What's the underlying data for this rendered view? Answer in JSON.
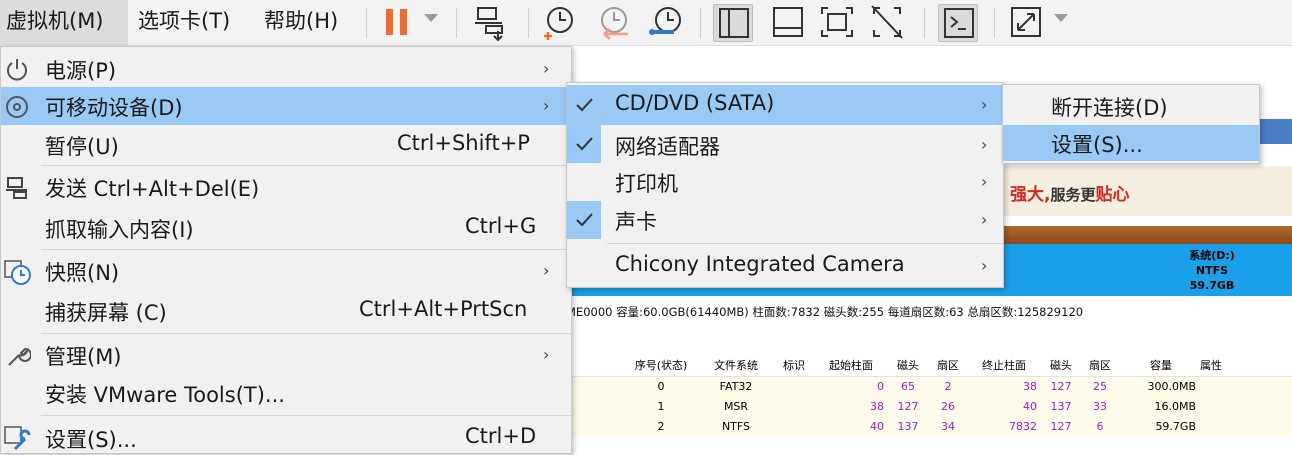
{
  "menubar": {
    "items": [
      "虚拟机(M)",
      "选项卡(T)",
      "帮助(H)"
    ]
  },
  "toolbar": {
    "icons": [
      "pause-icon",
      "send-ctrl-alt-del-icon",
      "snapshot-take-icon",
      "snapshot-revert-icon",
      "snapshot-manager-icon",
      "sidebar-view-icon",
      "thumbnail-view-icon",
      "fullscreen-icon",
      "unity-off-icon",
      "console-icon",
      "stretch-icon"
    ],
    "accent_pause": "#f26b2a"
  },
  "vm_menu": {
    "items": [
      {
        "label": "电源(P)",
        "shortcut": "",
        "submenu": true
      },
      {
        "label": "可移动设备(D)",
        "shortcut": "",
        "submenu": true
      },
      {
        "label": "暂停(U)",
        "shortcut": "Ctrl+Shift+P",
        "submenu": false
      },
      {
        "label": "发送 Ctrl+Alt+Del(E)",
        "shortcut": "",
        "submenu": false
      },
      {
        "label": "抓取输入内容(I)",
        "shortcut": "Ctrl+G",
        "submenu": false
      },
      {
        "label": "快照(N)",
        "shortcut": "",
        "submenu": true
      },
      {
        "label": "捕获屏幕 (C)",
        "shortcut": "Ctrl+Alt+PrtScn",
        "submenu": false
      },
      {
        "label": "管理(M)",
        "shortcut": "",
        "submenu": true
      },
      {
        "label": "安装 VMware Tools(T)...",
        "shortcut": "",
        "submenu": false
      },
      {
        "label": "设置(S)...",
        "shortcut": "Ctrl+D",
        "submenu": false
      }
    ]
  },
  "devices_menu": {
    "items": [
      {
        "label": "CD/DVD (SATA)",
        "checked": true
      },
      {
        "label": "网络适配器",
        "checked": true
      },
      {
        "label": "打印机",
        "checked": false
      },
      {
        "label": "声卡",
        "checked": true
      },
      {
        "label": "Chicony Integrated Camera",
        "checked": false
      }
    ]
  },
  "cd_menu": {
    "items": [
      "断开连接(D)",
      "设置(S)..."
    ]
  },
  "background": {
    "banner": "强大,",
    "banner_b": "服务更",
    "banner_c": "贴心",
    "disk_label": [
      "系统(D:)",
      "NTFS",
      "59.7GB"
    ],
    "info": "ME0000  容量:60.0GB(61440MB)  柱面数:7832  磁头数:255  每道扇区数:63  总扇区数:125829120",
    "table_headers": [
      "序号(状态)",
      "文件系统",
      "标识",
      "起始柱面",
      "磁头",
      "扇区",
      "终止柱面",
      "磁头",
      "扇区",
      "容量",
      "属性"
    ],
    "rows": [
      [
        "0",
        "FAT32",
        "",
        "0",
        "65",
        "2",
        "38",
        "127",
        "25",
        "300.0MB",
        ""
      ],
      [
        "1",
        "MSR",
        "",
        "38",
        "127",
        "26",
        "40",
        "137",
        "33",
        "16.0MB",
        ""
      ],
      [
        "2",
        "NTFS",
        "",
        "40",
        "137",
        "34",
        "7832",
        "127",
        "6",
        "59.7GB",
        ""
      ]
    ]
  }
}
